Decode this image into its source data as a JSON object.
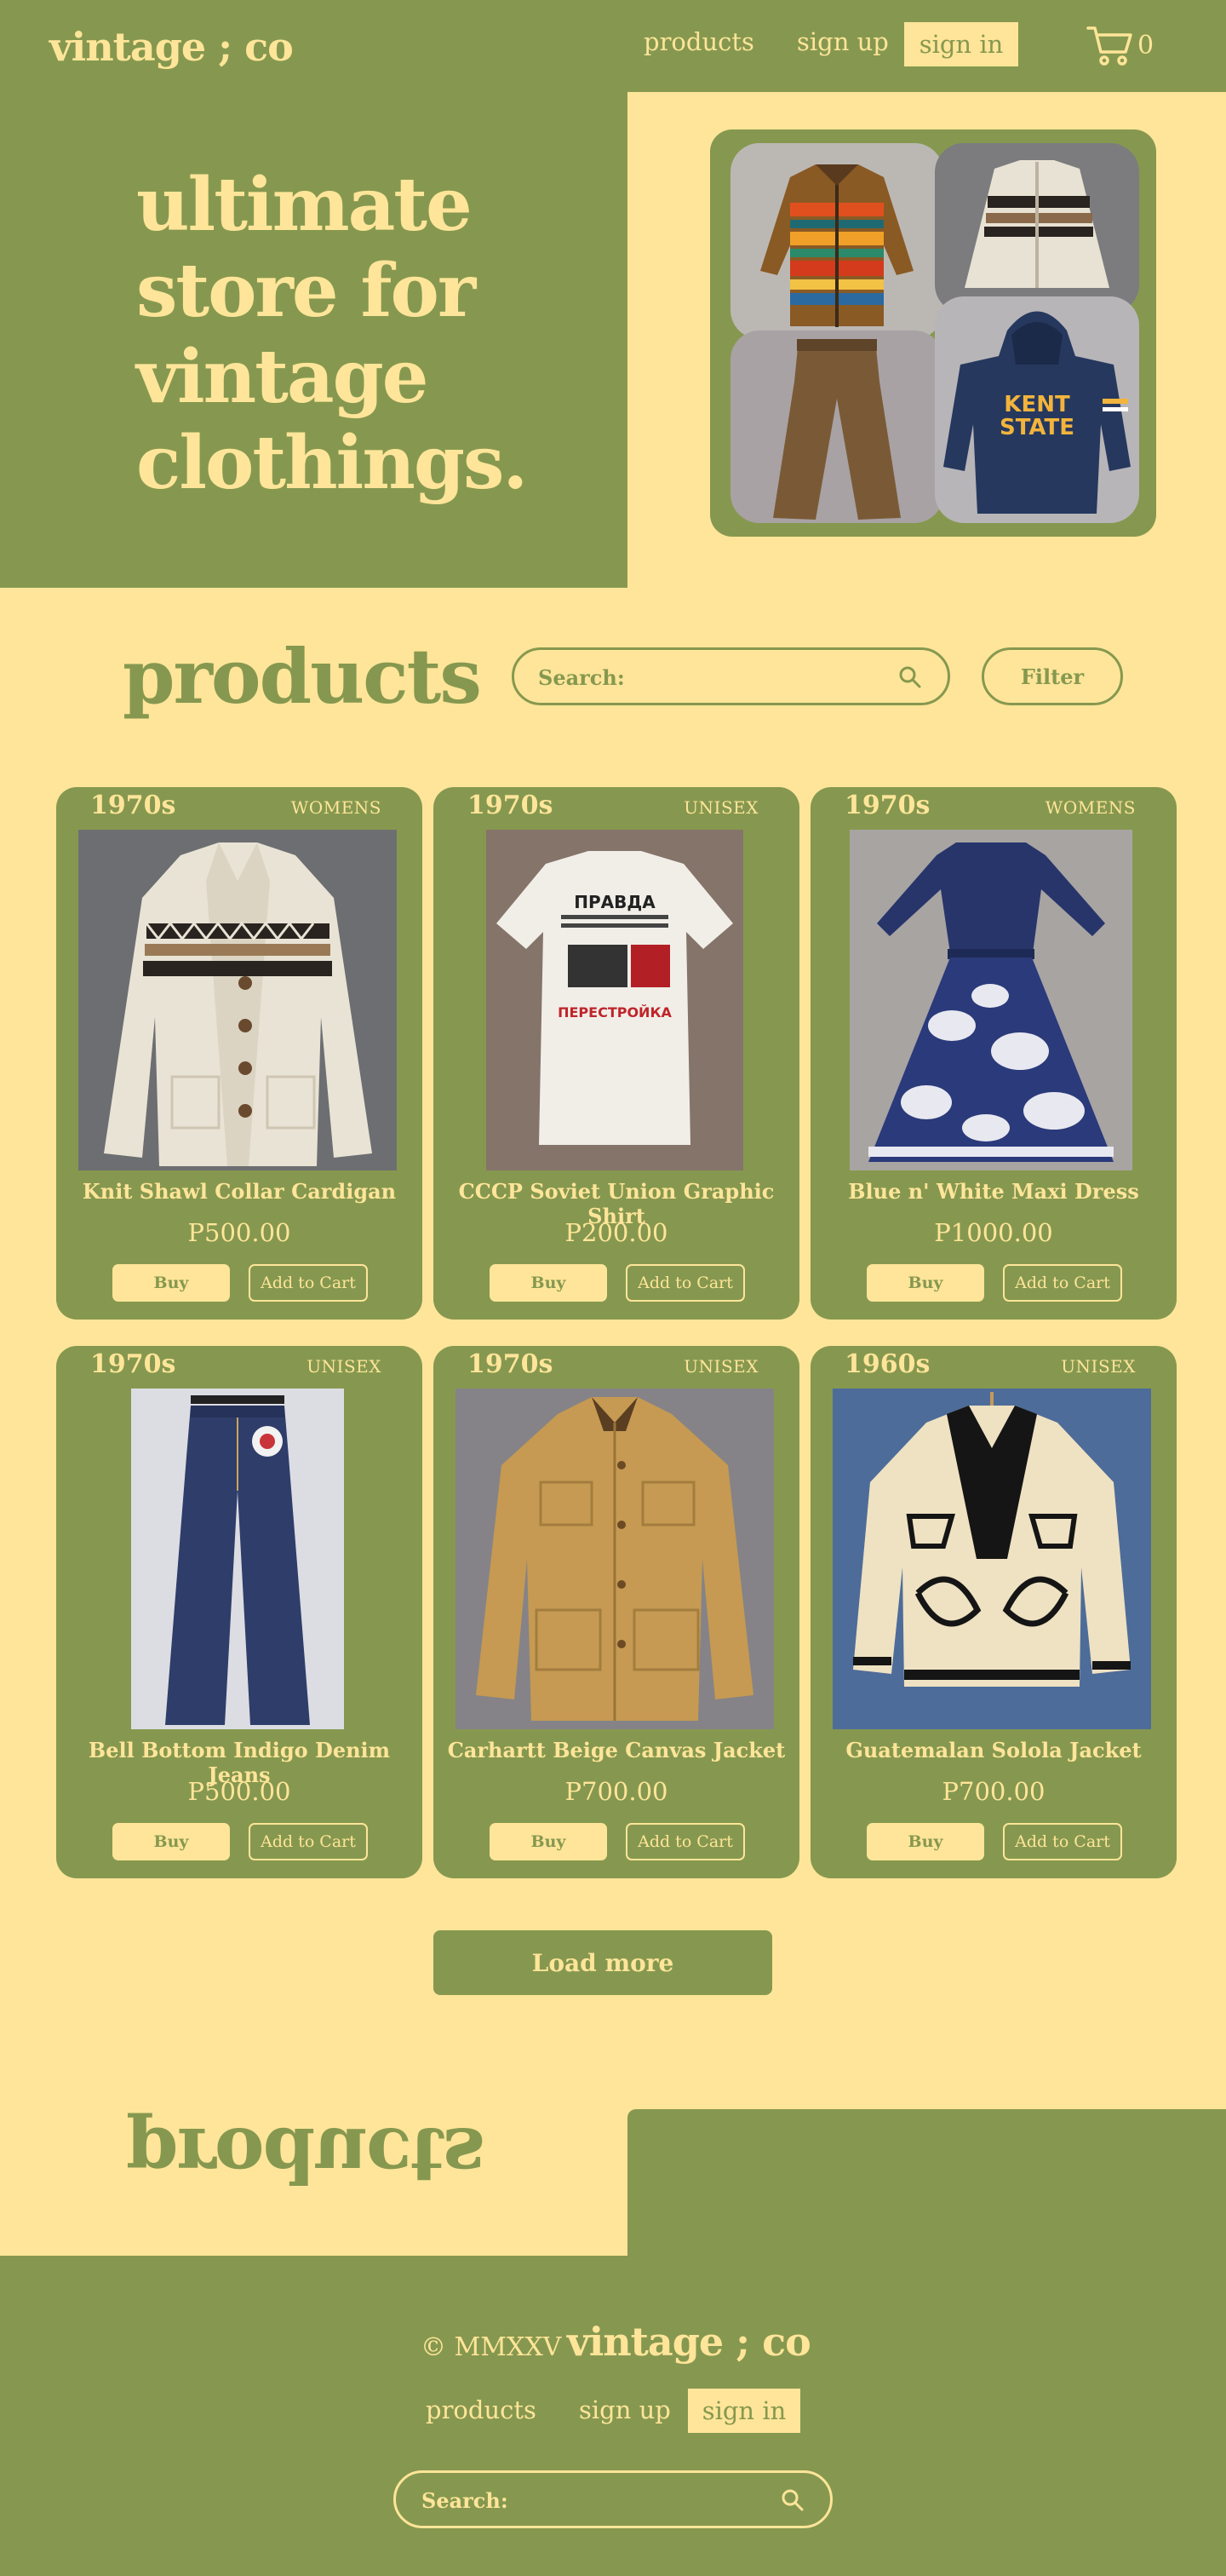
{
  "header": {
    "logo": "vintage ; co",
    "nav": {
      "products": "products",
      "sign_up": "sign up",
      "sign_in": "sign in"
    },
    "cart_count": "0"
  },
  "hero": {
    "title_lines": [
      "ultimate",
      "store for",
      "vintage",
      "clothings."
    ]
  },
  "products_section": {
    "heading": "products",
    "search_placeholder": "Search:",
    "filter_label": "Filter",
    "buy_label": "Buy",
    "add_to_cart_label": "Add to Cart",
    "items": [
      {
        "era": "1970s",
        "gender": "WOMENS",
        "name": "Knit Shawl Collar Cardigan",
        "price": "P500.00"
      },
      {
        "era": "1970s",
        "gender": "UNISEX",
        "name": "CCCP Soviet Union Graphic Shirt",
        "price": "P200.00"
      },
      {
        "era": "1970s",
        "gender": "WOMENS",
        "name": "Blue n' White Maxi Dress",
        "price": "P1000.00"
      },
      {
        "era": "1970s",
        "gender": "UNISEX",
        "name": "Bell Bottom Indigo Denim Jeans",
        "price": "P500.00"
      },
      {
        "era": "1970s",
        "gender": "UNISEX",
        "name": "Carhartt Beige Canvas Jacket",
        "price": "P700.00"
      },
      {
        "era": "1960s",
        "gender": "UNISEX",
        "name": "Guatemalan Solola Jacket",
        "price": "P700.00"
      }
    ],
    "load_more": "Load more"
  },
  "footer": {
    "flipped_heading": "products",
    "copyright": "© MMXXV",
    "logo": "vintage ; co",
    "nav": {
      "products": "products",
      "sign_up": "sign up",
      "sign_in": "sign in"
    },
    "search_placeholder": "Search:"
  },
  "colors": {
    "olive": "#86984f",
    "cream": "#fee599"
  }
}
